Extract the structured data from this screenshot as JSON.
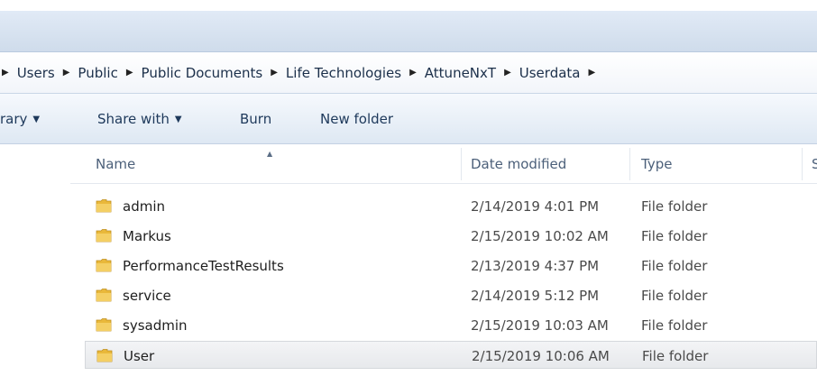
{
  "breadcrumb": {
    "items": [
      "Users",
      "Public",
      "Public Documents",
      "Life Technologies",
      "AttuneNxT",
      "Userdata"
    ]
  },
  "toolbar": {
    "library_label": "rary",
    "share_label": "Share with",
    "burn_label": "Burn",
    "new_folder_label": "New folder"
  },
  "columns": {
    "name": "Name",
    "date_modified": "Date modified",
    "type": "Type",
    "size_partial": "S"
  },
  "files": [
    {
      "name": "admin",
      "date": "2/14/2019 4:01 PM",
      "type": "File folder"
    },
    {
      "name": "Markus",
      "date": "2/15/2019 10:02 AM",
      "type": "File folder"
    },
    {
      "name": "PerformanceTestResults",
      "date": "2/13/2019 4:37 PM",
      "type": "File folder"
    },
    {
      "name": "service",
      "date": "2/14/2019 5:12 PM",
      "type": "File folder"
    },
    {
      "name": "sysadmin",
      "date": "2/15/2019 10:03 AM",
      "type": "File folder"
    },
    {
      "name": "User",
      "date": "2/15/2019 10:06 AM",
      "type": "File folder",
      "selected": true
    }
  ],
  "icons": {
    "folder": "folder-icon",
    "breadcrumb_separator": "chevron-right-icon",
    "dropdown": "chevron-down-icon",
    "sort": "sort-ascending-icon"
  },
  "colors": {
    "folder": "#e9b83a",
    "toolbar_text": "#1e395b",
    "selection": "#e7e9ec"
  }
}
